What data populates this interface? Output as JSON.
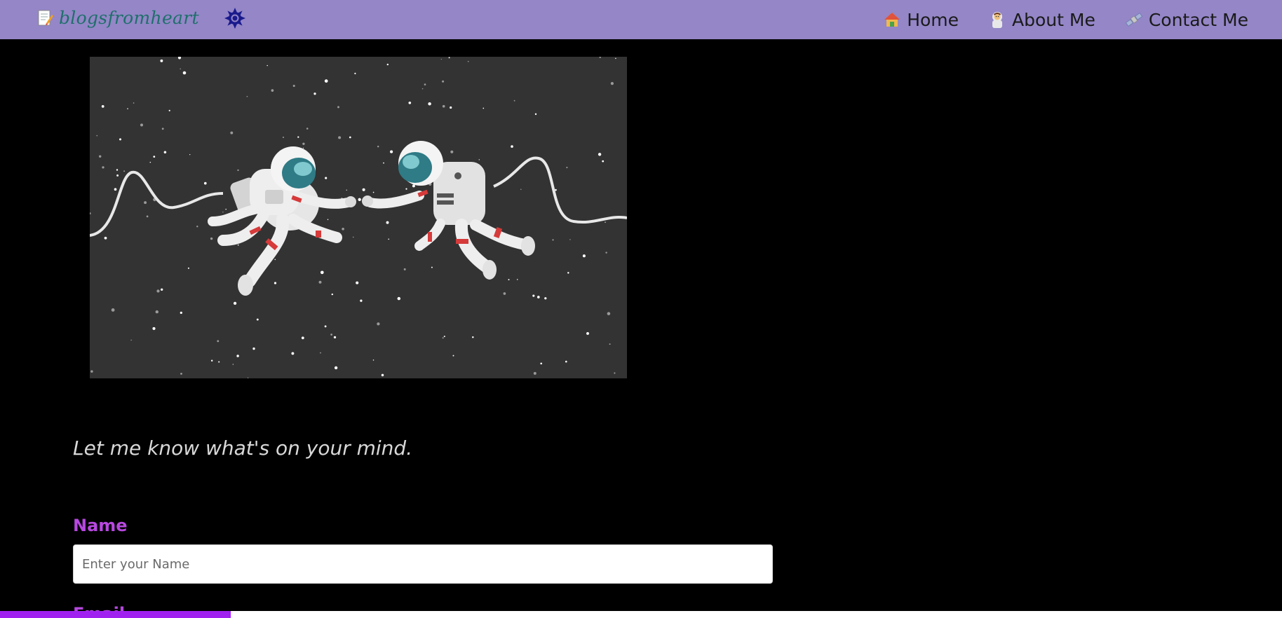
{
  "navbar": {
    "brand": {
      "icon": "memo-pencil-icon",
      "text": "blogsfromheart"
    },
    "theme_toggle_icon": "gear-sun-icon",
    "links": [
      {
        "label": "Home",
        "icon": "house-icon"
      },
      {
        "label": "About Me",
        "icon": "astronaut-icon"
      },
      {
        "label": "Contact Me",
        "icon": "satellite-icon"
      }
    ]
  },
  "hero": {
    "image": "astronauts-floating-in-space"
  },
  "tagline": "Let me know what's on your mind.",
  "form": {
    "name_label": "Name",
    "name_placeholder": "Enter your Name",
    "name_value": "",
    "email_label": "Email"
  },
  "scroll_progress": 0.18,
  "colors": {
    "navbar_bg": "#9486c7",
    "brand_text": "#1f6f6b",
    "page_bg": "#000000",
    "label": "#b748e0",
    "tagline": "#d8d8d8",
    "progress": "#a020f0",
    "theme_icon": "#1a1a8c"
  }
}
